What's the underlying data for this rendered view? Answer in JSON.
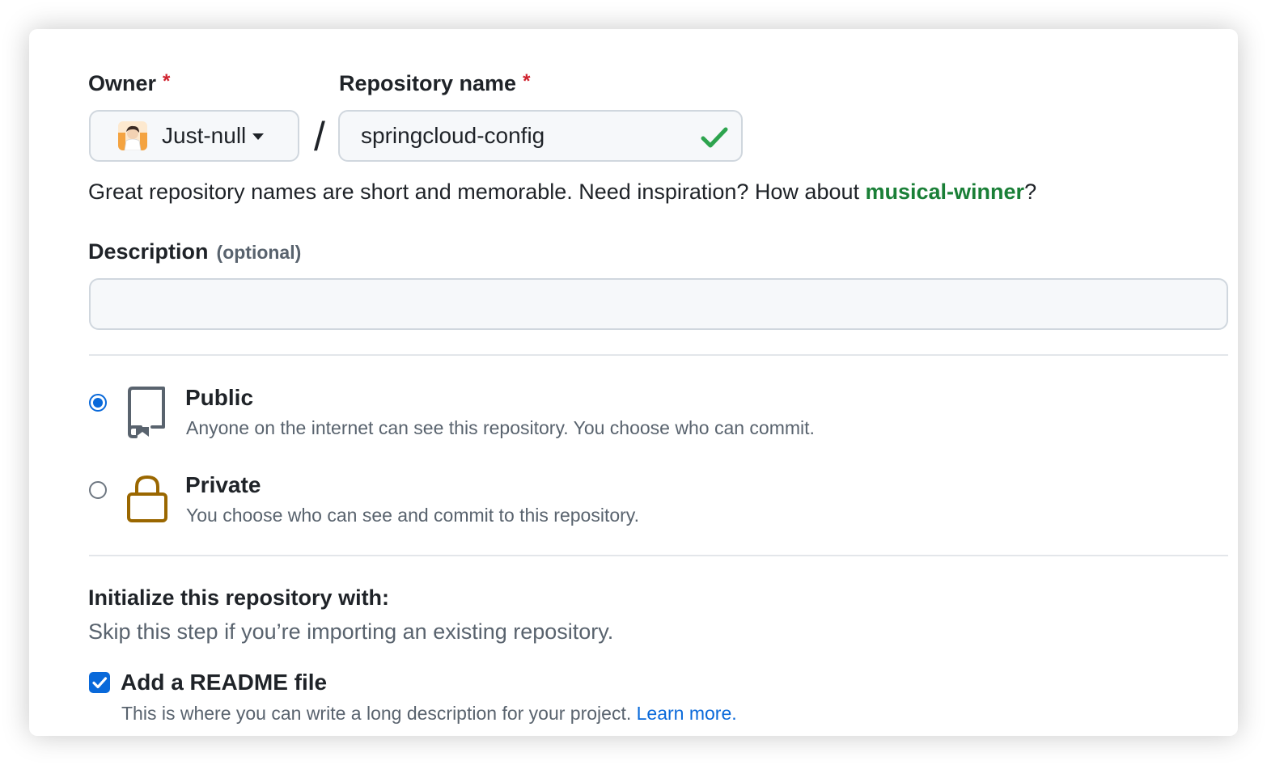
{
  "owner": {
    "label": "Owner",
    "required_mark": "*",
    "selected": "Just-null"
  },
  "repo": {
    "label": "Repository name",
    "required_mark": "*",
    "value": "springcloud-config",
    "valid": true
  },
  "separator": "/",
  "hint": {
    "text": "Great repository names are short and memorable. Need inspiration? How about ",
    "suggestion": "musical-winner",
    "suffix": "?"
  },
  "description": {
    "label": "Description",
    "optional": "(optional)",
    "value": "",
    "placeholder": ""
  },
  "visibility": {
    "options": [
      {
        "title": "Public",
        "desc": "Anyone on the internet can see this repository. You choose who can commit.",
        "icon": "repo-icon",
        "selected": true
      },
      {
        "title": "Private",
        "desc": "You choose who can see and commit to this repository.",
        "icon": "lock-icon",
        "selected": false
      }
    ]
  },
  "init": {
    "title": "Initialize this repository with:",
    "subtitle": "Skip this step if you’re importing an existing repository.",
    "readme": {
      "label": "Add a README file",
      "checked": true,
      "desc": "This is where you can write a long description for your project. ",
      "link": "Learn more."
    }
  },
  "colors": {
    "required": "#cf222e",
    "success": "#2da44e",
    "suggestion": "#1a7f37",
    "accent": "#0969da",
    "lock": "#9a6700"
  }
}
